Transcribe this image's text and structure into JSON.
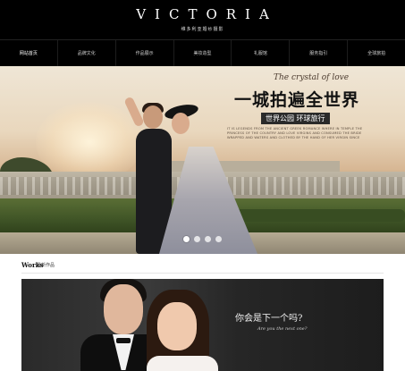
{
  "header": {
    "logo": "VICTORIA",
    "logo_sub": "维多利亚婚纱摄影"
  },
  "nav": {
    "items": [
      {
        "label": "网站首页",
        "active": true
      },
      {
        "label": "品牌文化",
        "active": false
      },
      {
        "label": "作品展示",
        "active": false
      },
      {
        "label": "美妆造型",
        "active": false
      },
      {
        "label": "礼服馆",
        "active": false
      },
      {
        "label": "服务指引",
        "active": false
      },
      {
        "label": "全球旅拍",
        "active": false
      }
    ]
  },
  "banner": {
    "script_title": "The crystal of love",
    "main_slogan": "一城拍遍全世界",
    "sub_slogan": "世界公园 环球旅行",
    "description": "IT IS LEGENDS FROM THE ANCIENT GREEK ROMANCE WHERE IN TEMPLE THE PRINCESS OF THE COUNTRY AND LOVE VIRGINS AND CONSUMED THE BRIDE WRAPPED AND WATERS AND CLOTHED BY THE HAND OF HER VIRGIN SINCE",
    "slide_count": 4,
    "active_slide": 1
  },
  "works": {
    "title_en": "Works",
    "title_cn": "最新作品",
    "question_cn": "你会是下一个吗?",
    "question_en": "Are you the next one?"
  },
  "colors": {
    "header_bg": "#000000",
    "nav_text": "#d0d0d0",
    "slogan": "#111111"
  }
}
